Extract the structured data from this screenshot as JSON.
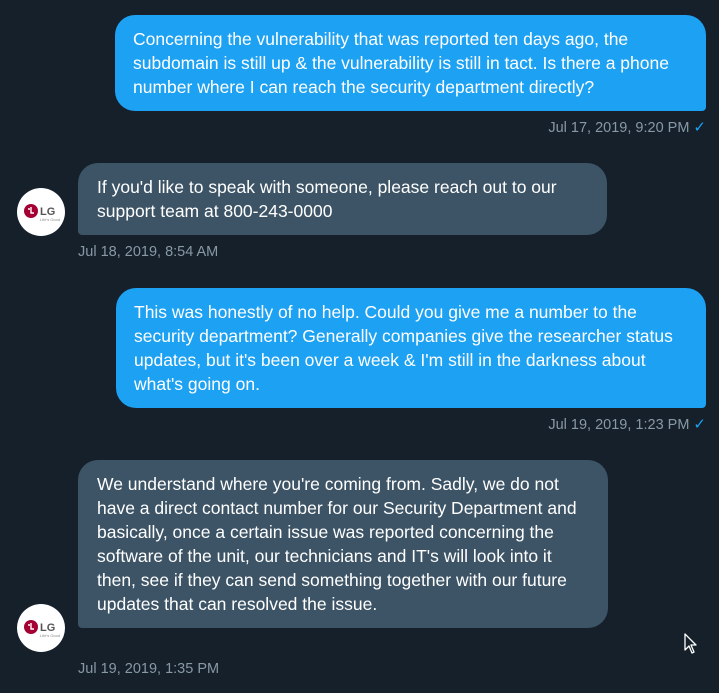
{
  "conversation": {
    "messages": [
      {
        "direction": "outgoing",
        "text": "Concerning the vulnerability that was reported ten days ago, the subdomain is still up & the vulnerability is still in tact. Is there a phone number where I can reach the security department directly?",
        "timestamp": "Jul 17, 2019, 9:20 PM",
        "read_icon": "checkmark-icon"
      },
      {
        "direction": "incoming",
        "text": "If you'd like to speak with someone, please reach out to our support team at 800-243-0000",
        "timestamp": "Jul 18, 2019, 8:54 AM"
      },
      {
        "direction": "outgoing",
        "text": "This was honestly of no help. Could you give me a number to the security department? Generally companies give the researcher status updates, but it's been over a week & I'm still in the darkness about what's going on.",
        "timestamp": "Jul 19, 2019, 1:23 PM",
        "read_icon": "checkmark-icon"
      },
      {
        "direction": "incoming",
        "text": "We understand where you're coming from. Sadly, we do not have a direct contact number for our Security Department and basically, once a certain issue was reported concerning the software of the unit, our technicians and IT's will look into it then, see if they can send something together with our future updates that can resolved the issue.",
        "timestamp": "Jul 19, 2019, 1:35 PM"
      }
    ]
  },
  "avatar": {
    "brand_text": "LG",
    "tagline": "Life's Good",
    "brand_color": "#a50034"
  },
  "colors": {
    "background": "#15202b",
    "outgoing_bubble": "#1da1f2",
    "incoming_bubble": "#3d5466",
    "timestamp_text": "#8899a6"
  }
}
